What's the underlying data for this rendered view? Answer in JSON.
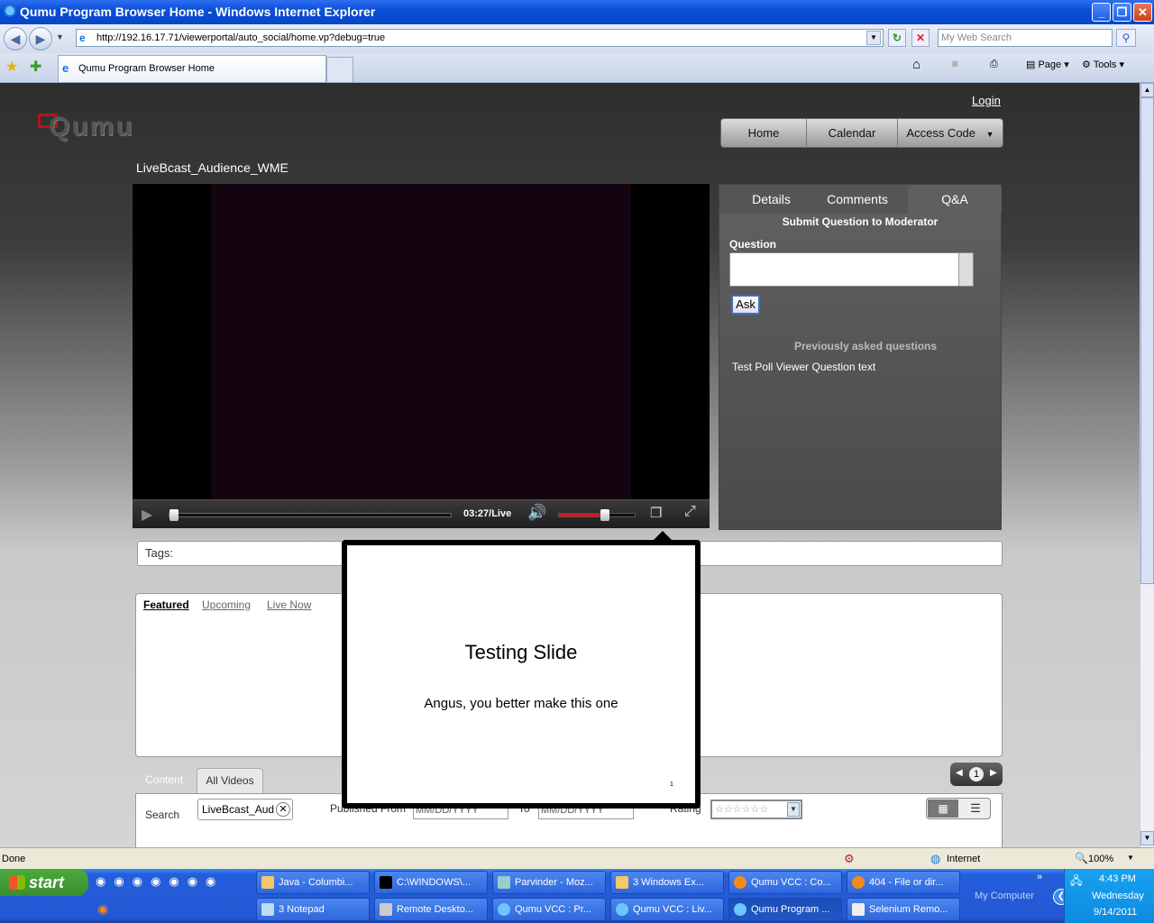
{
  "window": {
    "title": "Qumu Program Browser Home - Windows Internet Explorer"
  },
  "browser": {
    "url": "http://192.16.17.71/viewerportal/auto_social/home.vp?debug=true",
    "search_placeholder": "My Web Search",
    "tab_title": "Qumu Program Browser Home",
    "toolbar": {
      "page": "Page",
      "tools": "Tools"
    }
  },
  "site": {
    "logo_text": "Qumu",
    "login": "Login",
    "nav": [
      "Home",
      "Calendar",
      "Access Code"
    ],
    "program_title": "LiveBcast_Audience_WME"
  },
  "player": {
    "time": "03:27/Live",
    "progress": 0.0,
    "volume": 0.6
  },
  "panel": {
    "tabs": [
      "Details",
      "Comments",
      "Q&A"
    ],
    "active_tab": "Q&A",
    "heading": "Submit Question to Moderator",
    "question_label": "Question",
    "question_value": "",
    "ask_button": "Ask",
    "previous_heading": "Previously asked questions",
    "previous_items": [
      "Test Poll Viewer Question text"
    ]
  },
  "tags": {
    "label": "Tags:"
  },
  "lists": {
    "tabs": [
      "Featured",
      "Upcoming",
      "Live Now"
    ],
    "active": "Featured"
  },
  "content": {
    "tabs": [
      "Content",
      "All Videos"
    ],
    "active": "All Videos",
    "page_number": "1",
    "search_label": "Search",
    "search_value": "LiveBcast_Aud",
    "published_from_label": "Published From",
    "from_placeholder": "MM/DD/YYYY",
    "to_label": "To",
    "to_placeholder": "MM/DD/YYYY",
    "rating_label": "Rating",
    "rating_value": "☆☆☆☆☆☆"
  },
  "slide": {
    "title": "Testing Slide",
    "body": "Angus, you better make this one",
    "page": "1"
  },
  "status": {
    "left": "Done",
    "zone": "Internet",
    "zoom": "100%"
  },
  "taskbar": {
    "start": "start",
    "row1": [
      "Java - Columbi...",
      "C:\\WINDOWS\\...",
      "Parvinder - Moz...",
      "3 Windows Ex...",
      "Qumu VCC : Co...",
      "404 - File or dir..."
    ],
    "row2": [
      "3 Notepad",
      "Remote Deskto...",
      "Qumu VCC : Pr...",
      "Qumu VCC : Liv...",
      "Qumu Program ...",
      "Selenium Remo..."
    ],
    "my_computer": "My Computer",
    "clock": {
      "time": "4:43 PM",
      "day": "Wednesday",
      "date": "9/14/2011"
    }
  }
}
